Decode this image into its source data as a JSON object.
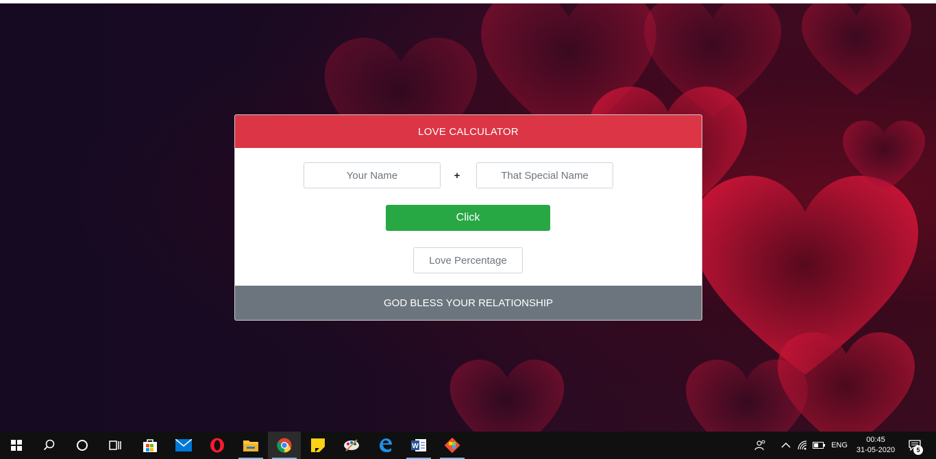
{
  "app": {
    "header_title": "LOVE CALCULATOR",
    "name1_placeholder": "Your Name",
    "plus_sign": "+",
    "name2_placeholder": "That Special Name",
    "click_label": "Click",
    "percent_placeholder": "Love Percentage",
    "footer_text": "GOD BLESS YOUR RELATIONSHIP"
  },
  "colors": {
    "header_bg": "#dc3545",
    "button_bg": "#28a745",
    "footer_bg": "#6c757d"
  },
  "taskbar": {
    "apps": [
      "start-icon",
      "search-icon",
      "cortana-icon",
      "task-view-icon",
      "store-icon",
      "mail-icon",
      "opera-icon",
      "file-explorer-icon",
      "chrome-icon",
      "sticky-notes-icon",
      "paint-icon",
      "edge-icon",
      "word-icon",
      "git-icon"
    ],
    "language": "ENG",
    "time": "00:45",
    "date": "31-05-2020",
    "notification_count": "5"
  }
}
